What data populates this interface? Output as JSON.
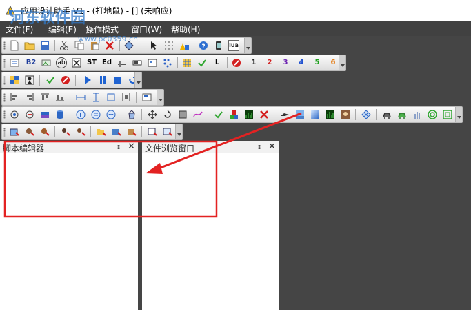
{
  "window": {
    "title": "应用设计助手 V1 - (打地鼠) - [] (未响应)"
  },
  "menu": {
    "items": [
      {
        "id": "file",
        "label": "文件(F)"
      },
      {
        "id": "edit",
        "label": "编辑(E)"
      },
      {
        "id": "mode",
        "label": "操作模式"
      },
      {
        "id": "window",
        "label": "窗口(W)"
      },
      {
        "id": "help",
        "label": "帮助(H)"
      }
    ]
  },
  "toolbar": {
    "text_buttons": {
      "b2": "B2",
      "ab": "ab",
      "st": "ST",
      "ed": "Ed",
      "l": "L",
      "n1": "1",
      "n2": "2",
      "n3": "3",
      "n4": "4",
      "n5": "5",
      "n6": "6",
      "lua": "lua"
    }
  },
  "panels": {
    "script_editor": {
      "title": "脚本编辑器",
      "pin": "ᵻ",
      "close": "✕"
    },
    "file_browser": {
      "title": "文件浏览窗口",
      "pin": "ᵻ",
      "close": "✕"
    }
  },
  "watermark": {
    "text": "河东软件园",
    "url": "www.pc0359.cn"
  },
  "colors": {
    "annotation_red": "#e32222",
    "menubar_bg": "#414141",
    "workspace_bg": "#454545"
  }
}
